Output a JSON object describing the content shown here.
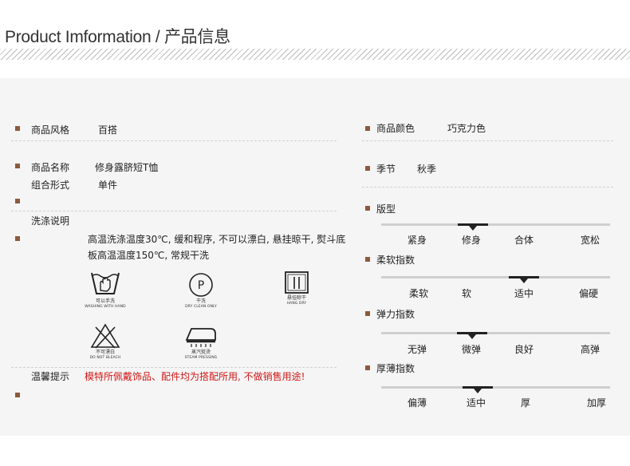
{
  "header": {
    "title": "Product Imformation / 产品信息"
  },
  "left": {
    "rows": [
      {
        "label": "商品风格",
        "value": "百搭"
      },
      {
        "label": "商品名称",
        "value": "修身露脐短T恤"
      },
      {
        "label": "组合形式",
        "value": "单件"
      },
      {
        "label": "洗涤说明",
        "value": ""
      }
    ],
    "wash_text": "高温洗涤温度30℃, 缓和程序, 不可以漂白, 悬挂晾干, 熨斗底板高温温度150℃, 常规干洗",
    "care_icons": [
      {
        "icon": "hand-wash-icon",
        "cn": "可以手洗",
        "en": "WASHING WITH HAND"
      },
      {
        "icon": "dry-clean-icon",
        "cn": "干洗",
        "en": "DRY CLEAN ONLY",
        "glyph": "P"
      },
      {
        "icon": "hang-dry-icon",
        "cn": "悬挂晾干",
        "en": "HANG DRY"
      },
      {
        "icon": "no-bleach-icon",
        "cn": "不可漂白",
        "en": "DO NOT BLEACH"
      },
      {
        "icon": "steam-iron-icon",
        "cn": "蒸汽熨烫",
        "en": "STEAM PRESSING"
      }
    ],
    "warm_label": "温馨提示",
    "warm_text": "模特所佩戴饰品、配件均为搭配所用, 不做销售用途!"
  },
  "right": {
    "rows": [
      {
        "label": "商品颜色",
        "value": "巧克力色"
      },
      {
        "label": "季节",
        "value": "秋季"
      }
    ],
    "scales": [
      {
        "label": "版型",
        "options": [
          "紧身",
          "修身",
          "合体",
          "宽松"
        ],
        "selected": 1
      },
      {
        "label": "柔软指数",
        "options": [
          "柔软",
          "软",
          "适中",
          "偏硬"
        ],
        "selected": 2
      },
      {
        "label": "弹力指数",
        "options": [
          "无弹",
          "微弹",
          "良好",
          "高弹"
        ],
        "selected": 1
      },
      {
        "label": "厚薄指数",
        "options": [
          "偏薄",
          "适中",
          "厚",
          "加厚"
        ],
        "selected": 1
      }
    ]
  },
  "colors": {
    "accent": "#8b5a3c",
    "warning": "#d01818",
    "marker": "#222222"
  }
}
